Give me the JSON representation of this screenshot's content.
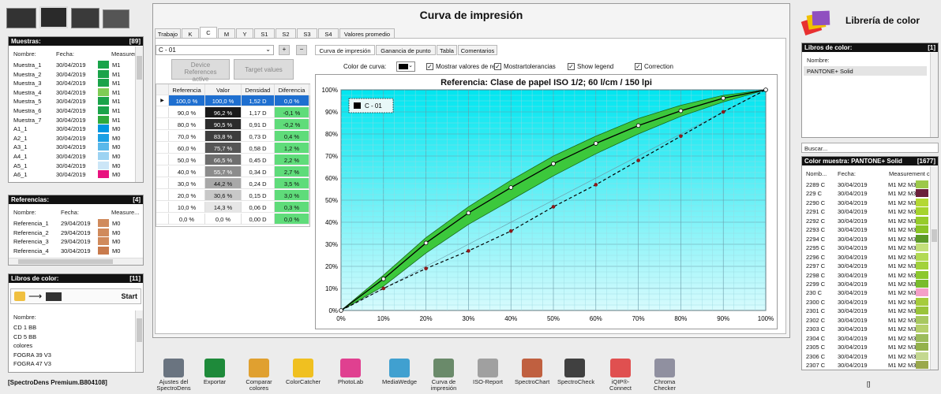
{
  "app": {
    "title": "Curva de impresión",
    "footer": "[SpectroDens Premium.B804108]"
  },
  "muestras": {
    "title": "Muestras:",
    "count": "[89]",
    "cols": [
      "Nombre:",
      "Fecha:",
      "Measurem"
    ],
    "rows": [
      {
        "name": "Muestra_1",
        "date": "30/04/2019",
        "m": "M1",
        "color": "#1aa34a"
      },
      {
        "name": "Muestra_2",
        "date": "30/04/2019",
        "m": "M1",
        "color": "#1aa34a"
      },
      {
        "name": "Muestra_3",
        "date": "30/04/2019",
        "m": "M1",
        "color": "#1aa34a"
      },
      {
        "name": "Muestra_4",
        "date": "30/04/2019",
        "m": "M1",
        "color": "#7fcc55"
      },
      {
        "name": "Muestra_5",
        "date": "30/04/2019",
        "m": "M1",
        "color": "#1aa34a"
      },
      {
        "name": "Muestra_6",
        "date": "30/04/2019",
        "m": "M1",
        "color": "#1aa34a"
      },
      {
        "name": "Muestra_7",
        "date": "30/04/2019",
        "m": "M1",
        "color": "#2eaa3c"
      },
      {
        "name": "A1_1",
        "date": "30/04/2019",
        "m": "M0",
        "color": "#0096e0"
      },
      {
        "name": "A2_1",
        "date": "30/04/2019",
        "m": "M0",
        "color": "#1ba0e4"
      },
      {
        "name": "A3_1",
        "date": "30/04/2019",
        "m": "M0",
        "color": "#5ab8ea"
      },
      {
        "name": "A4_1",
        "date": "30/04/2019",
        "m": "M0",
        "color": "#9dd3f2"
      },
      {
        "name": "A5_1",
        "date": "30/04/2019",
        "m": "M0",
        "color": "#cce6f7"
      },
      {
        "name": "A6_1",
        "date": "30/04/2019",
        "m": "M0",
        "color": "#e8137f"
      }
    ]
  },
  "referencias": {
    "title": "Referencias:",
    "count": "[4]",
    "cols": [
      "Nombre:",
      "Fecha:",
      "Measure..."
    ],
    "rows": [
      {
        "name": "Referencia_1",
        "date": "29/04/2019",
        "m": "M0",
        "color": "#d08a5c"
      },
      {
        "name": "Referencia_2",
        "date": "29/04/2019",
        "m": "M0",
        "color": "#d08a5c"
      },
      {
        "name": "Referencia_3",
        "date": "29/04/2019",
        "m": "M0",
        "color": "#d08a5c"
      },
      {
        "name": "Referencia_4",
        "date": "30/04/2019",
        "m": "M0",
        "color": "#c87a4c"
      }
    ]
  },
  "libros_left": {
    "title": "Libros de color:",
    "count": "[11]",
    "start": "Start",
    "col": "Nombre:",
    "rows": [
      "CD 1 BB",
      "CD 5 BB",
      "colores",
      "FOGRA 39 V3",
      "FOGRA 47 V3"
    ]
  },
  "tabs": [
    "Trabajo",
    "K",
    "C",
    "M",
    "Y",
    "S1",
    "S2",
    "S3",
    "S4",
    "Valores promedio"
  ],
  "active_tab": "C",
  "select_value": "C - 01",
  "plus": "+",
  "minus": "−",
  "btn_device": "Device References active",
  "btn_target": "Target values",
  "table": {
    "cols": [
      "Referencia",
      "Valor",
      "Densidad",
      "Diferencia"
    ],
    "rows": [
      {
        "ref": "100,0 %",
        "val": "100,0 %",
        "den": "1,52 D",
        "dif": "0,0 %"
      },
      {
        "ref": "90,0 %",
        "val": "96,2 %",
        "den": "1,17 D",
        "dif": "-0,1 %"
      },
      {
        "ref": "80,0 %",
        "val": "90,5 %",
        "den": "0,91 D",
        "dif": "-0,2 %"
      },
      {
        "ref": "70,0 %",
        "val": "83,8 %",
        "den": "0,73 D",
        "dif": "0,4 %"
      },
      {
        "ref": "60,0 %",
        "val": "75,7 %",
        "den": "0,58 D",
        "dif": "1,2 %"
      },
      {
        "ref": "50,0 %",
        "val": "66,5 %",
        "den": "0,45 D",
        "dif": "2,2 %"
      },
      {
        "ref": "40,0 %",
        "val": "55,7 %",
        "den": "0,34 D",
        "dif": "2,7 %"
      },
      {
        "ref": "30,0 %",
        "val": "44,2 %",
        "den": "0,24 D",
        "dif": "3,5 %"
      },
      {
        "ref": "20,0 %",
        "val": "30,6 %",
        "den": "0,15 D",
        "dif": "3,0 %"
      },
      {
        "ref": "10,0 %",
        "val": "14,3 %",
        "den": "0,06 D",
        "dif": "0,3 %"
      },
      {
        "ref": "0,0 %",
        "val": "0,0 %",
        "den": "0,00 D",
        "dif": "0,0 %"
      }
    ]
  },
  "subtabs": [
    "Curva de impresión",
    "Ganancia de punto",
    "Tabla",
    "Comentarios"
  ],
  "options": {
    "color_label": "Color de curva:",
    "show_values": "Mostrar valores de re",
    "show_tol": "Mostrartolerancias",
    "show_legend": "Show legend",
    "correction": "Correction"
  },
  "chart_data": {
    "type": "line",
    "title": "Referencia: Clase de papel ISO 1/2; 60 l/cm / 150 lpi",
    "legend": "C - 01",
    "legend_position": "top-left",
    "xlim": [
      0,
      100
    ],
    "ylim": [
      0,
      100
    ],
    "x_ticks": [
      "0%",
      "10%",
      "20%",
      "30%",
      "40%",
      "50%",
      "60%",
      "70%",
      "80%",
      "90%",
      "100%"
    ],
    "y_ticks": [
      "0%",
      "10%",
      "20%",
      "30%",
      "40%",
      "50%",
      "60%",
      "70%",
      "80%",
      "90%",
      "100%"
    ],
    "grid": true,
    "series": [
      {
        "name": "C - 01",
        "x": [
          0,
          10,
          20,
          30,
          40,
          50,
          60,
          70,
          80,
          90,
          100
        ],
        "y": [
          0,
          14.3,
          30.6,
          44.2,
          55.7,
          66.5,
          75.7,
          83.8,
          90.5,
          96.2,
          100
        ],
        "color": "#000000"
      },
      {
        "x": [
          0,
          10,
          20,
          30,
          40,
          50,
          60,
          70,
          80,
          90,
          100
        ],
        "y": [
          0,
          10,
          19,
          27,
          36,
          47,
          57,
          68,
          79,
          90,
          100
        ],
        "color": "#8b1a1a"
      }
    ],
    "tolerance_band": {
      "x": [
        0,
        10,
        20,
        30,
        40,
        50,
        60,
        70,
        80,
        90,
        100
      ],
      "upper": [
        0,
        16,
        33,
        47,
        59,
        70,
        79,
        87,
        93,
        97.5,
        100
      ],
      "lower": [
        0,
        11,
        26,
        39,
        50,
        61,
        71,
        80,
        88,
        94.5,
        100
      ],
      "color": "#3cc83c"
    }
  },
  "libreria": {
    "title": "Librería de color",
    "libros_title": "Libros de color:",
    "libros_count": "[1]",
    "libros_col": "Nombre:",
    "libros_rows": [
      "PANTONE+ Solid"
    ],
    "search_label": "Buscar...",
    "muestra_title": "Color muestra: PANTONE+ Solid",
    "muestra_count": "[1677]",
    "cols": [
      "Nomb...",
      "Fecha:",
      "Measurement c"
    ],
    "rows": [
      {
        "name": "2289 C",
        "date": "30/04/2019",
        "m": "M1 M2 M3 M0",
        "color": "#9cc94a"
      },
      {
        "name": "229 C",
        "date": "30/04/2019",
        "m": "M1 M2 M3 M0",
        "color": "#6b1f3a"
      },
      {
        "name": "2290 C",
        "date": "30/04/2019",
        "m": "M1 M2 M3 M0",
        "color": "#b4d834"
      },
      {
        "name": "2291 C",
        "date": "30/04/2019",
        "m": "M1 M2 M3 M0",
        "color": "#a6d42e"
      },
      {
        "name": "2292 C",
        "date": "30/04/2019",
        "m": "M1 M2 M3 M0",
        "color": "#96cc2a"
      },
      {
        "name": "2293 C",
        "date": "30/04/2019",
        "m": "M1 M2 M3 M0",
        "color": "#8ac426"
      },
      {
        "name": "2294 C",
        "date": "30/04/2019",
        "m": "M1 M2 M3 M0",
        "color": "#5c9a28"
      },
      {
        "name": "2295 C",
        "date": "30/04/2019",
        "m": "M1 M2 M3 M0",
        "color": "#c4e07a"
      },
      {
        "name": "2296 C",
        "date": "30/04/2019",
        "m": "M1 M2 M3 M0",
        "color": "#b2da54"
      },
      {
        "name": "2297 C",
        "date": "30/04/2019",
        "m": "M1 M2 M3 M0",
        "color": "#a2d23c"
      },
      {
        "name": "2298 C",
        "date": "30/04/2019",
        "m": "M1 M2 M3 M0",
        "color": "#8cc82e"
      },
      {
        "name": "2299 C",
        "date": "30/04/2019",
        "m": "M1 M2 M3 M0",
        "color": "#78bc2c"
      },
      {
        "name": "230 C",
        "date": "30/04/2019",
        "m": "M1 M2 M3 M0",
        "color": "#f4a0c8"
      },
      {
        "name": "2300 C",
        "date": "30/04/2019",
        "m": "M1 M2 M3 M0",
        "color": "#a6cc3c"
      },
      {
        "name": "2301 C",
        "date": "30/04/2019",
        "m": "M1 M2 M3 M0",
        "color": "#9ac43a"
      },
      {
        "name": "2302 C",
        "date": "30/04/2019",
        "m": "M1 M2 M3 M0",
        "color": "#a8c860"
      },
      {
        "name": "2303 C",
        "date": "30/04/2019",
        "m": "M1 M2 M3 M0",
        "color": "#b6d06c"
      },
      {
        "name": "2304 C",
        "date": "30/04/2019",
        "m": "M1 M2 M3 M0",
        "color": "#9cbc5c"
      },
      {
        "name": "2305 C",
        "date": "30/04/2019",
        "m": "M1 M2 M3 M0",
        "color": "#94b24c"
      },
      {
        "name": "2306 C",
        "date": "30/04/2019",
        "m": "M1 M2 M3 M0",
        "color": "#c4d890"
      },
      {
        "name": "2307 C",
        "date": "30/04/2019",
        "m": "M1 M2 M3 M0",
        "color": "#9aa84c"
      }
    ],
    "bottom": "[]"
  },
  "toolbar": [
    {
      "id": "ajustes",
      "label": "Ajustes del SpectroDens",
      "color": "#6a7480"
    },
    {
      "id": "exportar",
      "label": "Exportar",
      "color": "#1e8a3a"
    },
    {
      "id": "comparar",
      "label": "Comparar colores",
      "color": "#e0a030"
    },
    {
      "id": "colorcatcher",
      "label": "ColorCatcher",
      "color": "#f0c020"
    },
    {
      "id": "photolab",
      "label": "PhotoLab",
      "color": "#e04090"
    },
    {
      "id": "mediawedge",
      "label": "MediaWedge",
      "color": "#40a0d0"
    },
    {
      "id": "curva",
      "label": "Curva de impresión",
      "color": "#6a8a6a"
    },
    {
      "id": "isoreport",
      "label": "ISO-Report",
      "color": "#a0a0a0"
    },
    {
      "id": "spectrochart",
      "label": "SpectroChart",
      "color": "#c06040"
    },
    {
      "id": "spectrocheck",
      "label": "SpectroCheck",
      "color": "#404040"
    },
    {
      "id": "iqip",
      "label": "iQIP®-Connect",
      "color": "#e05050"
    },
    {
      "id": "chroma",
      "label": "Chroma Checker",
      "color": "#9090a0"
    }
  ]
}
